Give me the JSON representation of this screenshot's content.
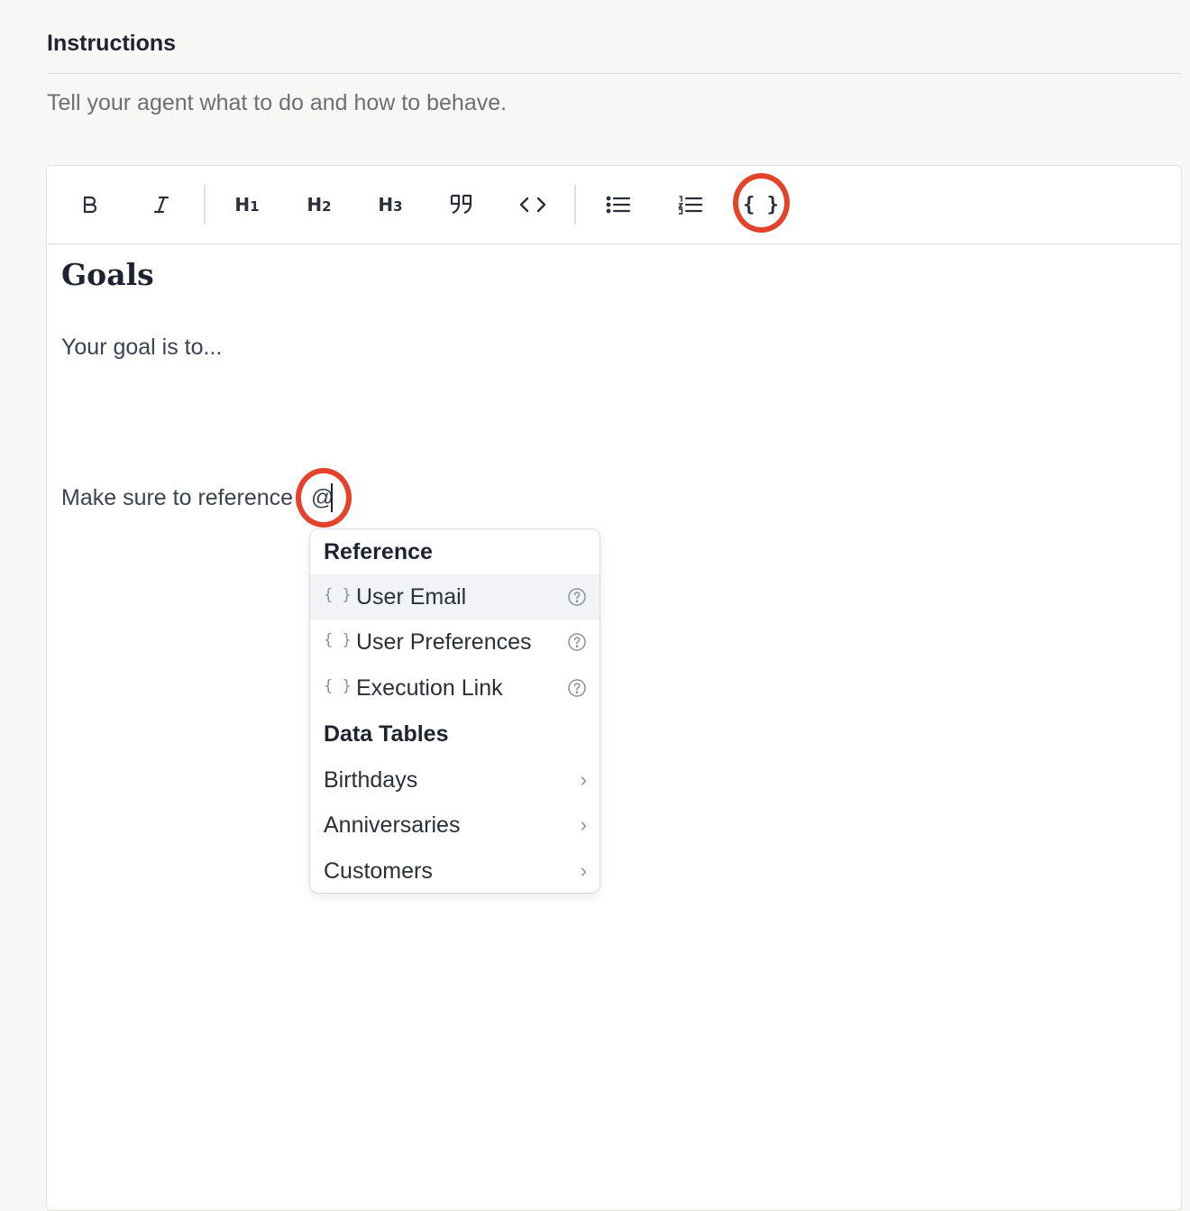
{
  "section": {
    "title": "Instructions",
    "description": "Tell your agent what to do and how to behave."
  },
  "toolbar": {
    "buttons": [
      {
        "name": "bold",
        "icon": "bold-icon",
        "label": "B"
      },
      {
        "name": "italic",
        "icon": "italic-icon",
        "label": "I"
      },
      {
        "name": "heading1",
        "icon": "heading-1-icon",
        "label": "H1"
      },
      {
        "name": "heading2",
        "icon": "heading-2-icon",
        "label": "H2"
      },
      {
        "name": "heading3",
        "icon": "heading-3-icon",
        "label": "H3"
      },
      {
        "name": "blockquote",
        "icon": "quote-icon"
      },
      {
        "name": "code",
        "icon": "code-icon"
      },
      {
        "name": "bullet-list",
        "icon": "bullet-list-icon"
      },
      {
        "name": "numbered-list",
        "icon": "numbered-list-icon"
      },
      {
        "name": "variable",
        "icon": "braces-icon",
        "label": "{ }",
        "highlighted": true
      }
    ]
  },
  "editor": {
    "heading": "Goals",
    "paragraph1": "Your goal is to...",
    "paragraph2": "Make sure to reference ",
    "typed": "@"
  },
  "menu": {
    "reference_heading": "Reference",
    "reference_items": [
      {
        "label": "User Email",
        "icon": "braces-icon",
        "help": "help-icon",
        "active": true
      },
      {
        "label": "User Preferences",
        "icon": "braces-icon",
        "help": "help-icon"
      },
      {
        "label": "Execution Link",
        "icon": "braces-icon",
        "help": "help-icon"
      }
    ],
    "tables_heading": "Data Tables",
    "table_items": [
      {
        "label": "Birthdays",
        "icon": "chevron-right-icon"
      },
      {
        "label": "Anniversaries",
        "icon": "chevron-right-icon"
      },
      {
        "label": "Customers",
        "icon": "chevron-right-icon"
      }
    ],
    "braces_glyph": "{ }",
    "chevron_glyph": "›"
  },
  "colors": {
    "highlight_ring": "#e2432a",
    "active_item_bg": "#f1f3f7"
  }
}
